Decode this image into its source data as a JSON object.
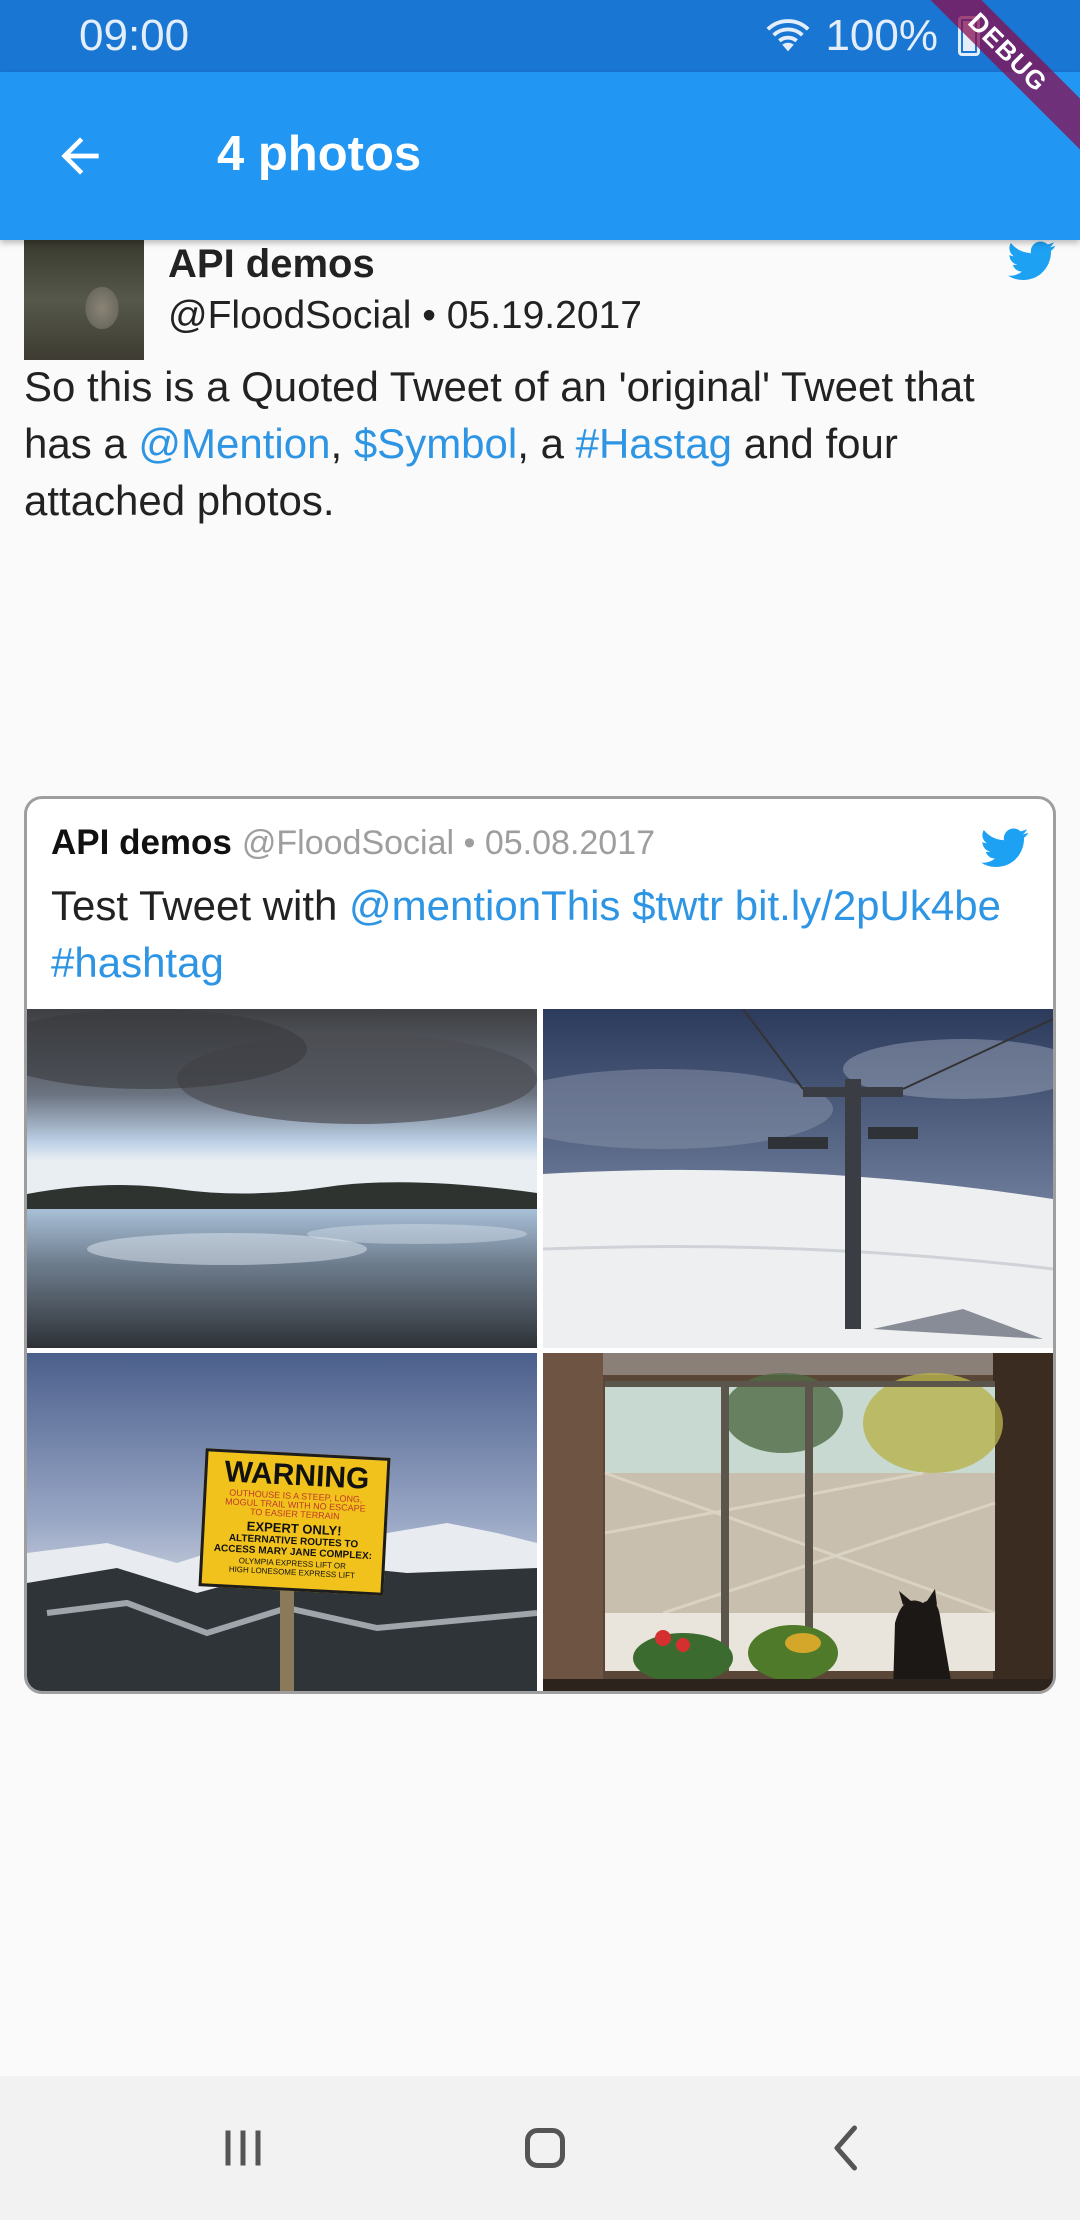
{
  "status_bar": {
    "time": "09:00",
    "battery": "100%",
    "debug_banner": "DEBUG"
  },
  "app_bar": {
    "title": "4 photos",
    "back_icon": "arrow-back-icon"
  },
  "tweet": {
    "author_name": "API demos",
    "handle": "@FloodSocial",
    "separator": " • ",
    "date": "05.19.2017",
    "text_parts": {
      "t1": "So this is a Quoted Tweet of an 'original' Tweet that has a ",
      "mention": "@Mention",
      "t2": ",  ",
      "symbol": "$Symbol",
      "t3": ", a ",
      "hashtag": "#Hastag",
      "t4": " and four attached photos."
    }
  },
  "quoted_tweet": {
    "author_name": "API demos",
    "handle": "@FloodSocial",
    "separator": " • ",
    "date": "05.08.2017",
    "text_parts": {
      "t1": "Test Tweet with ",
      "mention": "@mentionThis",
      "t2": " ",
      "symbol": "$twtr",
      "t3": " ",
      "url": "bit.ly/2pUk4be",
      "t4": " ",
      "hashtag": "#hashtag"
    },
    "photos": [
      "lake-photo",
      "ski-lift-photo",
      "warning-sign-photo",
      "window-cat-photo"
    ],
    "warning_sign": {
      "heading": "WARNING",
      "line1": "OUTHOUSE IS A STEEP, LONG,",
      "line2": "MOGUL TRAIL WITH NO ESCAPE",
      "line3": "TO EASIER TERRAIN",
      "line4": "EXPERT ONLY!",
      "line5": "ALTERNATIVE ROUTES TO",
      "line6": "ACCESS MARY JANE COMPLEX:",
      "line7": "OLYMPIA EXPRESS LIFT OR",
      "line8": "HIGH LONESOME EXPRESS LIFT"
    }
  },
  "colors": {
    "app_bar": "#2196f3",
    "status_bar": "#1976d2",
    "link": "#2d95e3",
    "twitter_blue": "#1da1f2"
  },
  "nav_bar": {
    "recents_icon": "recents-icon",
    "home_icon": "home-icon",
    "back_icon": "nav-back-icon"
  }
}
